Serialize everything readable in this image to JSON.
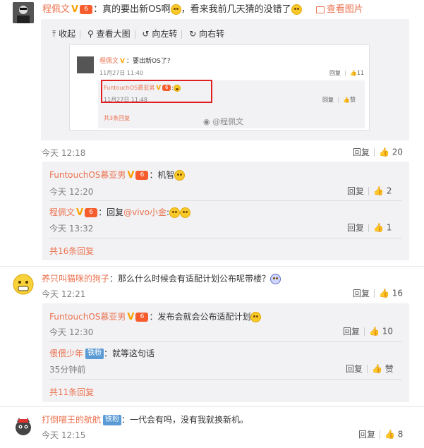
{
  "top_comment": {
    "user": "程佩文",
    "text": "：真的要出新OS啊",
    "text2": "，看来我前几天猜的没错了",
    "view_image": "查看图片"
  },
  "image_toolbar": {
    "collapse": "收起",
    "view_large": "查看大图",
    "rotate_left": "向左转",
    "rotate_right": "向右转"
  },
  "embedded": {
    "user": "程佩文",
    "text": "：要出新OS了?",
    "time": "11月27日 11:40",
    "reply": "回复",
    "likes": "11",
    "sub_user": "FuntouchOS慕亚男",
    "sub_time": "11月27日 11:48",
    "sub_reply": "回复",
    "sub_like": "赞",
    "more": "共3条回复",
    "watermark": "@程佩文"
  },
  "comment1": {
    "time": "今天 12:18",
    "reply": "回复",
    "likes": "20"
  },
  "reply1": {
    "user": "FuntouchOS慕亚男",
    "text": "：机智",
    "time": "今天 12:20",
    "reply": "回复",
    "likes": "2"
  },
  "reply2": {
    "user": "程佩文",
    "text": "：回复",
    "mention": "@vivo小金",
    "after": ":",
    "time": "今天 13:32",
    "reply": "回复",
    "likes": "1"
  },
  "more1": "共16条回复",
  "comment2": {
    "user": "养只叫猫咪的狗子",
    "text": "：那么什么时候会有适配计划公布呢带楼？",
    "time": "今天 12:21",
    "reply": "回复",
    "likes": "16"
  },
  "reply3": {
    "user": "FuntouchOS慕亚男",
    "text": "：发布会就会公布适配计划",
    "time": "今天 12:30",
    "reply": "回复",
    "likes": "10"
  },
  "reply4": {
    "user": "偎偎少年",
    "badge": "铁粉",
    "text": "：就等这句话",
    "time": "35分钟前",
    "reply": "回复",
    "likes": "赞"
  },
  "more2": "共11条回复",
  "comment3": {
    "user": "打倒喵王的航航",
    "badge": "铁粉",
    "text": "：一代会有吗，没有我就换新机。",
    "time": "今天 12:15",
    "reply": "回复",
    "likes": "8"
  }
}
